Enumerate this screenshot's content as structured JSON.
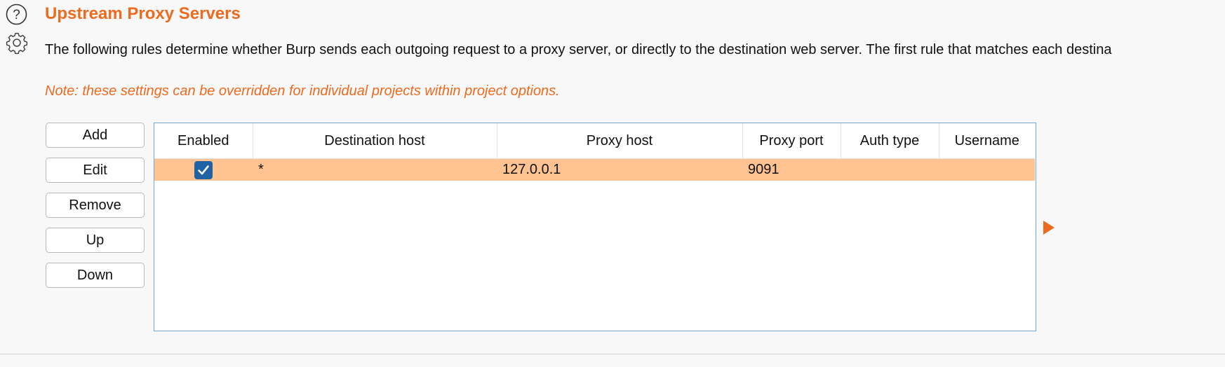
{
  "section": {
    "title": "Upstream Proxy Servers",
    "description": "The following rules determine whether Burp sends each outgoing request to a proxy server, or directly to the destination web server. The first rule that matches each destina",
    "note": "Note: these settings can be overridden for individual projects within project options.",
    "accent_color": "#ee6a1f"
  },
  "buttons": {
    "add": "Add",
    "edit": "Edit",
    "remove": "Remove",
    "up": "Up",
    "down": "Down"
  },
  "table": {
    "columns": [
      "Enabled",
      "Destination host",
      "Proxy host",
      "Proxy port",
      "Auth type",
      "Username"
    ],
    "rows": [
      {
        "enabled": true,
        "destination_host": "*",
        "proxy_host": "127.0.0.1",
        "proxy_port": "9091",
        "auth_type": "",
        "username": ""
      }
    ],
    "selected_row_color": "#fec390"
  },
  "icons": {
    "help": "help-icon",
    "settings": "gear-icon",
    "checkbox_checked": "checkmark-icon",
    "expand_arrow": "arrow-right-icon"
  }
}
